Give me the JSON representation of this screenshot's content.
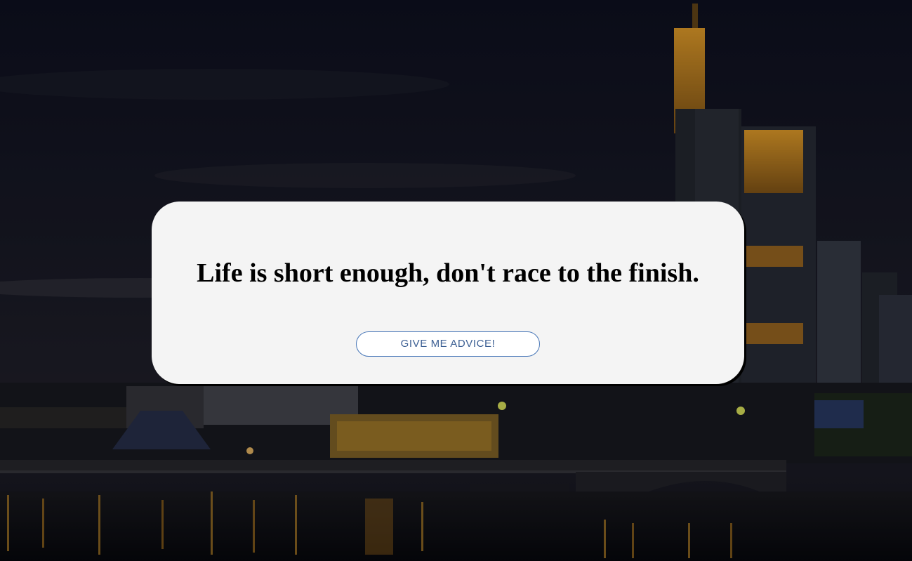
{
  "background": {
    "scene": "city-skyline-at-night-over-river",
    "colors": {
      "sky_top": "#0f1122",
      "sky_mid": "#1c1d2a",
      "glow": "#e39a2a",
      "water": "#0a0c14"
    }
  },
  "card": {
    "quote": "Life is short enough, don't race to the finish.",
    "button_label": "GIVE ME ADVICE!",
    "colors": {
      "card_bg": "#f4f4f4",
      "button_border": "#4a78b8",
      "button_text": "#3c5f93"
    }
  }
}
